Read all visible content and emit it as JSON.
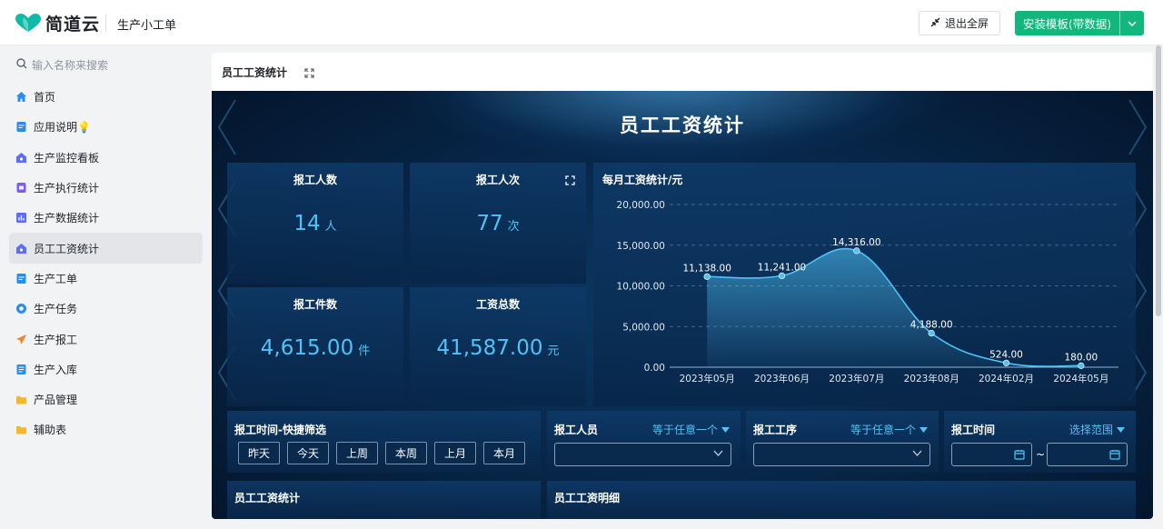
{
  "header": {
    "logo_text": "简道云",
    "app_name": "生产小工单",
    "exit_fullscreen": "退出全屏",
    "install_template": "安装模板(带数据)"
  },
  "sidebar": {
    "search_placeholder": "输入名称来搜索",
    "items": [
      {
        "label": "首页",
        "icon": "home-icon",
        "color": "#2b8cf0"
      },
      {
        "label": "应用说明💡",
        "icon": "doc-icon",
        "color": "#2b8cf0"
      },
      {
        "label": "生产监控看板",
        "icon": "dashboard-home-icon",
        "color": "#5b6ef5"
      },
      {
        "label": "生产执行统计",
        "icon": "form-icon",
        "color": "#7b5cf5"
      },
      {
        "label": "生产数据统计",
        "icon": "bar-chart-icon",
        "color": "#5b6ef5"
      },
      {
        "label": "员工工资统计",
        "icon": "dashboard-home-icon",
        "color": "#5b6ef5"
      },
      {
        "label": "生产工单",
        "icon": "doc-icon",
        "color": "#2b8cf0"
      },
      {
        "label": "生产任务",
        "icon": "gear-icon",
        "color": "#2b8cf0"
      },
      {
        "label": "生产报工",
        "icon": "send-icon",
        "color": "#f5822b"
      },
      {
        "label": "生产入库",
        "icon": "list-icon",
        "color": "#2b8cf0"
      },
      {
        "label": "产品管理",
        "icon": "folder-icon",
        "color": "#f5b82b"
      },
      {
        "label": "辅助表",
        "icon": "folder-icon",
        "color": "#f5b82b"
      }
    ]
  },
  "panel": {
    "title": "员工工资统计",
    "dashboard_title": "员工工资统计"
  },
  "stats": [
    {
      "label": "报工人数",
      "value": "14",
      "unit": "人"
    },
    {
      "label": "报工人次",
      "value": "77",
      "unit": "次"
    },
    {
      "label": "报工件数",
      "value": "4,615.00",
      "unit": "件"
    },
    {
      "label": "工资总数",
      "value": "41,587.00",
      "unit": "元"
    }
  ],
  "chart_data": {
    "type": "area",
    "title": "每月工资统计/元",
    "categories": [
      "2023年05月",
      "2023年06月",
      "2023年07月",
      "2023年08月",
      "2024年02月",
      "2024年05月"
    ],
    "values": [
      11138,
      11241,
      14316,
      4188,
      524,
      180
    ],
    "value_labels": [
      "11,138.00",
      "11,241.00",
      "14,316.00",
      "4,188.00",
      "524.00",
      "180.00"
    ],
    "ylim": [
      0,
      20000
    ],
    "y_ticks": [
      "0.00",
      "5,000.00",
      "10,000.00",
      "15,000.00",
      "20,000.00"
    ],
    "y_tick_values": [
      0,
      5000,
      10000,
      15000,
      20000
    ],
    "grid": true,
    "line_color": "#4fc3f7"
  },
  "filters": {
    "quick": {
      "label": "报工时间-快捷筛选",
      "buttons": [
        "昨天",
        "今天",
        "上周",
        "本周",
        "上月",
        "本月"
      ]
    },
    "staff": {
      "label": "报工人员",
      "op": "等于任意一个"
    },
    "process": {
      "label": "报工工序",
      "op": "等于任意一个"
    },
    "time": {
      "label": "报工时间",
      "op": "选择范围",
      "separator": "~"
    }
  },
  "bottom": {
    "left_title": "员工工资统计",
    "right_title": "员工工资明细"
  }
}
